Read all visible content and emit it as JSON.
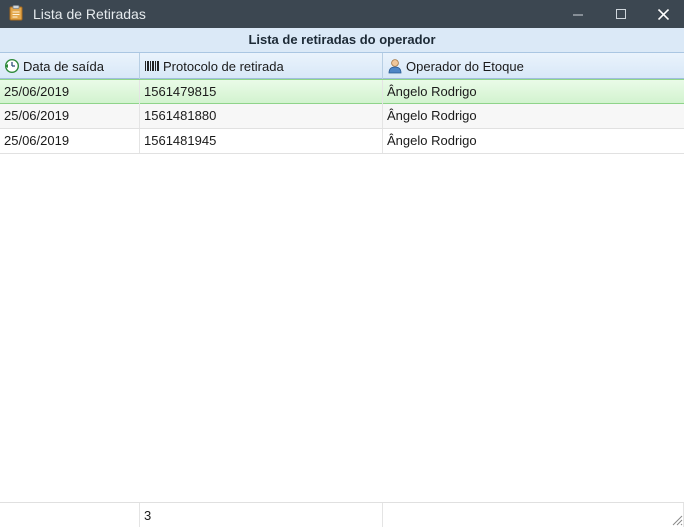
{
  "window": {
    "title": "Lista de Retiradas",
    "app_icon": "clipboard-icon",
    "controls": {
      "minimize": "minimize-icon",
      "maximize": "maximize-icon",
      "close": "close-icon"
    }
  },
  "table": {
    "caption": "Lista de retiradas do operador",
    "columns": [
      {
        "label": "Data de saída",
        "icon": "clock-arrow-icon"
      },
      {
        "label": "Protocolo de retirada",
        "icon": "barcode-icon"
      },
      {
        "label": "Operador do Etoque",
        "icon": "user-icon"
      }
    ],
    "rows": [
      {
        "date": "25/06/2019",
        "protocol": "1561479815",
        "operator": "Ângelo Rodrigo",
        "selected": true
      },
      {
        "date": "25/06/2019",
        "protocol": "1561481880",
        "operator": "Ângelo Rodrigo",
        "selected": false
      },
      {
        "date": "25/06/2019",
        "protocol": "1561481945",
        "operator": "Ângelo Rodrigo",
        "selected": false
      }
    ],
    "footer": {
      "count": "3"
    }
  },
  "colors": {
    "titlebar": "#3c4751",
    "header": "#dbe9f7",
    "selected_row": "#d2f3cf"
  }
}
